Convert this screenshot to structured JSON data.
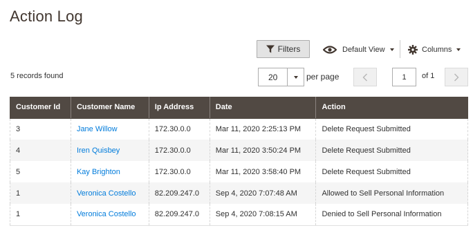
{
  "page": {
    "title": "Action Log"
  },
  "toolbar": {
    "filters_label": "Filters",
    "filter_icon": "funnel-icon",
    "view_icon": "eye-icon",
    "view_label": "Default View",
    "columns_icon": "gear-icon",
    "columns_label": "Columns"
  },
  "pagination": {
    "records_text": "5 records found",
    "per_page_value": "20",
    "per_page_label": "per page",
    "current_page": "1",
    "of_pages": "of 1"
  },
  "table": {
    "columns": [
      "Customer Id",
      "Customer Name",
      "Ip Address",
      "Date",
      "Action"
    ],
    "rows": [
      {
        "id": "3",
        "name": "Jane Willow",
        "ip": "172.30.0.0",
        "date": "Mar 11, 2020 2:25:13 PM",
        "action": "Delete Request Submitted"
      },
      {
        "id": "4",
        "name": "Iren Quisbey",
        "ip": "172.30.0.0",
        "date": "Mar 11, 2020 3:50:24 PM",
        "action": "Delete Request Submitted"
      },
      {
        "id": "5",
        "name": "Kay Brighton",
        "ip": "172.30.0.0",
        "date": "Mar 11, 2020 3:58:40 PM",
        "action": "Delete Request Submitted"
      },
      {
        "id": "1",
        "name": "Veronica Costello",
        "ip": "82.209.247.0",
        "date": "Sep 4, 2020 7:07:48 AM",
        "action": "Allowed to Sell Personal Information"
      },
      {
        "id": "1",
        "name": "Veronica Costello",
        "ip": "82.209.247.0",
        "date": "Sep 4, 2020 7:08:15 AM",
        "action": "Denied to Sell Personal Information"
      }
    ]
  },
  "colors": {
    "header_bg": "#514943",
    "link": "#007bdb",
    "title": "#41362f",
    "stripe": "#f5f5f5"
  }
}
